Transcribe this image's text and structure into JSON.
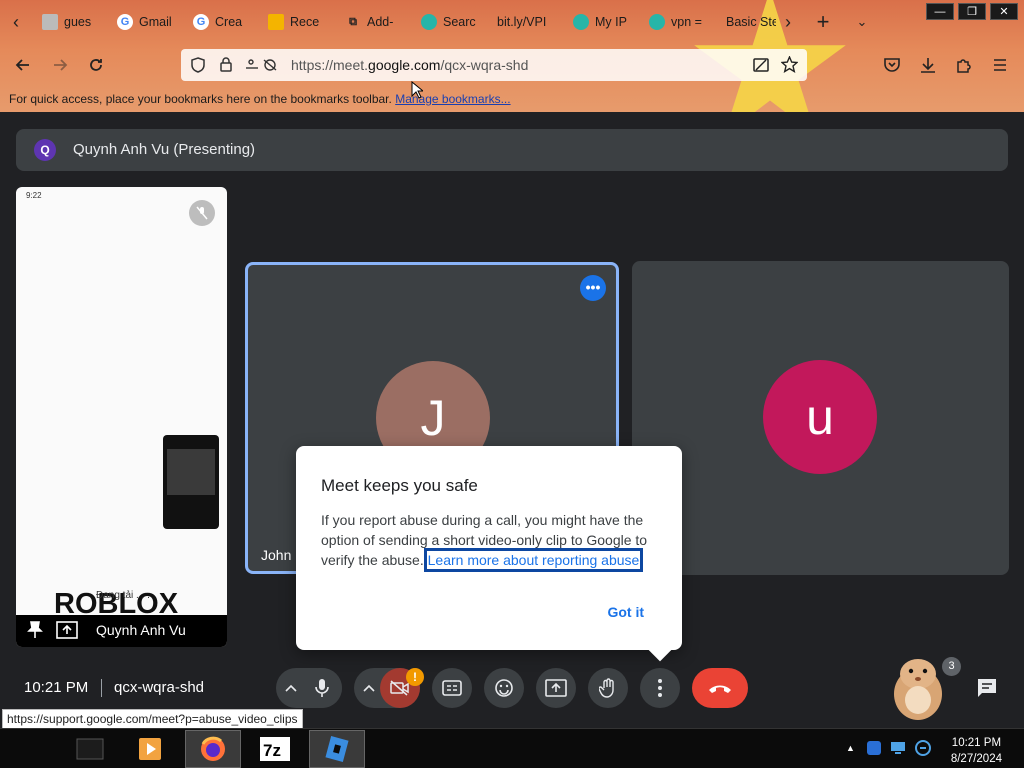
{
  "browser": {
    "tabs": [
      {
        "label": "gues",
        "icon": "roblox-icon"
      },
      {
        "label": "Gmail",
        "icon": "google-icon"
      },
      {
        "label": "Crea",
        "icon": "google-icon"
      },
      {
        "label": "Rece",
        "icon": "chart-icon"
      },
      {
        "label": "Add-",
        "icon": "puzzle-icon"
      },
      {
        "label": "Searc",
        "icon": "shield-icon"
      },
      {
        "label": "bit.ly/VPI",
        "icon": ""
      },
      {
        "label": "My IP",
        "icon": "shield-icon"
      },
      {
        "label": "vpn =",
        "icon": "shield-icon"
      },
      {
        "label": "Basic Ste",
        "icon": ""
      }
    ],
    "url_prefix": "https://meet.",
    "url_domain": "google.com",
    "url_path": "/qcx-wqra-shd",
    "bookmarks_text": "For quick access, place your bookmarks here on the bookmarks toolbar.",
    "bookmarks_link": "Manage bookmarks..."
  },
  "meet": {
    "presenter_initial": "Q",
    "presenting_label": "Quynh Anh Vu (Presenting)",
    "share_tile": {
      "status_time": "9:22",
      "logo": "ROBLOX",
      "loading_text": "Đang tải . . .",
      "name": "Quynh Anh Vu"
    },
    "participants": [
      {
        "initial": "J",
        "name": "John",
        "color": "#9b6e63"
      },
      {
        "initial": "u",
        "name": "",
        "color": "#c2185b"
      }
    ],
    "dialog": {
      "title": "Meet keeps you safe",
      "body": "If you report abuse during a call, you might have the option of sending a short video-only clip to Google to verify the abuse.",
      "link": "Learn more about reporting abuse",
      "button": "Got it"
    },
    "controls": {
      "time": "10:21 PM",
      "meeting_code": "qcx-wqra-shd",
      "alert_badge": "!",
      "people_count": "3"
    },
    "status_url": "https://support.google.com/meet?p=abuse_video_clips"
  },
  "taskbar": {
    "clock_time": "10:21 PM",
    "clock_date": "8/27/2024",
    "apps": [
      "terminal-icon",
      "media-player-icon",
      "firefox-icon",
      "7zip-icon",
      "roblox-studio-icon"
    ]
  },
  "colors": {
    "accent": "#1a73e8",
    "end_call": "#ea4335",
    "meet_bg": "#202124"
  }
}
